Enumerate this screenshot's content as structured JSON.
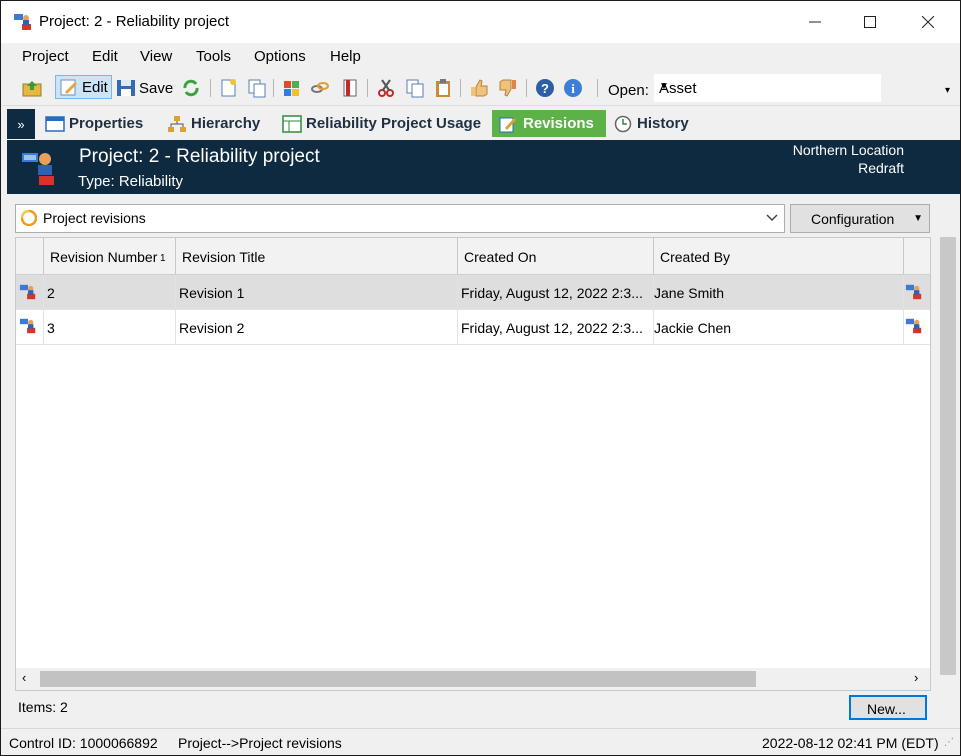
{
  "window": {
    "title": "Project: 2 - Reliability project",
    "minimize": "—",
    "maximize": "☐",
    "close": "✕"
  },
  "menu": [
    "Project",
    "Edit",
    "View",
    "Tools",
    "Options",
    "Help"
  ],
  "toolbar": {
    "edit_label": "Edit",
    "save_label": "Save",
    "open_label": "Open:",
    "open_value": "Asset"
  },
  "tabs": [
    {
      "label": "Properties",
      "icon": "properties-icon"
    },
    {
      "label": "Hierarchy",
      "icon": "hierarchy-icon"
    },
    {
      "label": "Reliability Project Usage",
      "icon": "grid-icon"
    },
    {
      "label": "Revisions",
      "icon": "revisions-icon",
      "active": true
    },
    {
      "label": "History",
      "icon": "history-icon"
    }
  ],
  "header": {
    "title": "Project: 2 - Reliability project",
    "type": "Type: Reliability",
    "location": "Northern Location",
    "state": "Redraft"
  },
  "query": {
    "label": "Project revisions",
    "config_label": "Configuration"
  },
  "grid": {
    "columns": [
      "Revision Number",
      "Revision Title",
      "Created On",
      "Created By"
    ],
    "sort_indicator": "1",
    "rows": [
      {
        "number": "2",
        "title": "Revision 1",
        "created_on": "Friday, August 12, 2022 2:3...",
        "created_by": "Jane Smith",
        "selected": true
      },
      {
        "number": "3",
        "title": "Revision 2",
        "created_on": "Friday, August 12, 2022 2:3...",
        "created_by": "Jackie Chen",
        "selected": false
      }
    ]
  },
  "footer": {
    "items": "Items: 2",
    "new_button": "New..."
  },
  "status": {
    "control_id": "Control ID: 1000066892",
    "path": "Project-->Project revisions",
    "datetime": "2022-08-12 02:41 PM (EDT)"
  },
  "colors": {
    "header_bg": "#0e2a40",
    "active_tab": "#5cb247",
    "selection": "#dedede"
  }
}
